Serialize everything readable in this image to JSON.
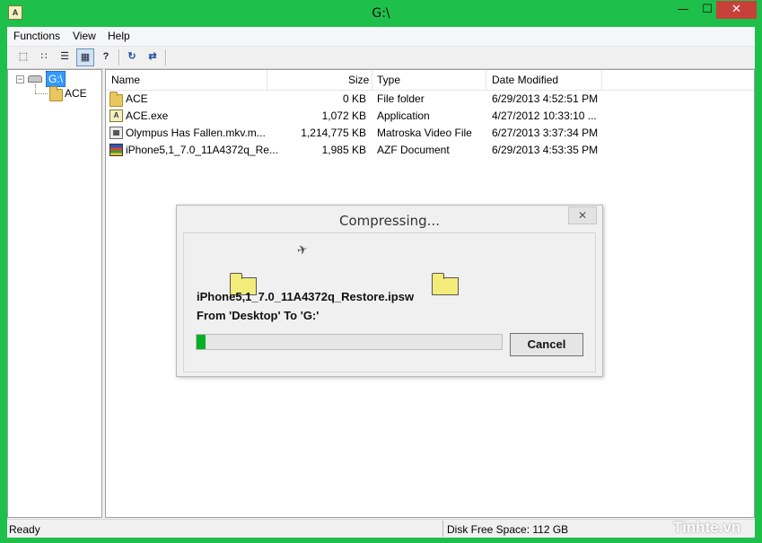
{
  "window": {
    "title": "G:\\",
    "min_glyph": "—",
    "max_glyph": "☐",
    "close_glyph": "✕"
  },
  "menu": {
    "items": [
      "Functions",
      "View",
      "Help"
    ]
  },
  "toolbar": {
    "buttons": [
      {
        "icon": "large-icons-icon",
        "glyph": "⬚"
      },
      {
        "icon": "small-icons-icon",
        "glyph": "∷"
      },
      {
        "icon": "list-view-icon",
        "glyph": "☰"
      },
      {
        "icon": "details-view-icon",
        "glyph": "▦",
        "active": true
      },
      {
        "icon": "help-icon",
        "glyph": "?"
      },
      {
        "icon": "refresh-icon",
        "glyph": "↻"
      },
      {
        "icon": "sync-icon",
        "glyph": "⇄"
      }
    ]
  },
  "tree": {
    "root": "G:\\",
    "children": [
      "ACE"
    ],
    "expander": "−"
  },
  "list": {
    "columns": [
      "Name",
      "Size",
      "Type",
      "Date Modified"
    ],
    "rows": [
      {
        "icon": "folder-icon",
        "name": "ACE",
        "size": "0 KB",
        "type": "File folder",
        "date": "6/29/2013 4:52:51 PM"
      },
      {
        "icon": "application-icon",
        "name": "ACE.exe",
        "size": "1,072 KB",
        "type": "Application",
        "date": "4/27/2012 10:33:10 ..."
      },
      {
        "icon": "video-file-icon",
        "name": "Olympus Has Fallen.mkv.m...",
        "size": "1,214,775 KB",
        "type": "Matroska Video File",
        "date": "6/27/2013 3:37:34 PM"
      },
      {
        "icon": "azf-document-icon",
        "name": "iPhone5,1_7.0_11A4372q_Re...",
        "size": "1,985 KB",
        "type": "AZF Document",
        "date": "6/29/2013 4:53:35 PM"
      }
    ]
  },
  "dialog": {
    "title": "Compressing...",
    "close_glyph": "✕",
    "file": "iPhone5,1_7.0_11A4372q_Restore.ipsw",
    "path": "From 'Desktop' To 'G:'",
    "progress": 0.03,
    "progress_color": "#06b025",
    "cancel_label": "Cancel"
  },
  "status": {
    "left": "Ready",
    "right": "Disk Free Space: 112 GB"
  },
  "watermark": "Tinhte.vn",
  "colors": {
    "frame": "#1fbf4b",
    "close_button": "#c7413a",
    "selection": "#3399ff"
  }
}
